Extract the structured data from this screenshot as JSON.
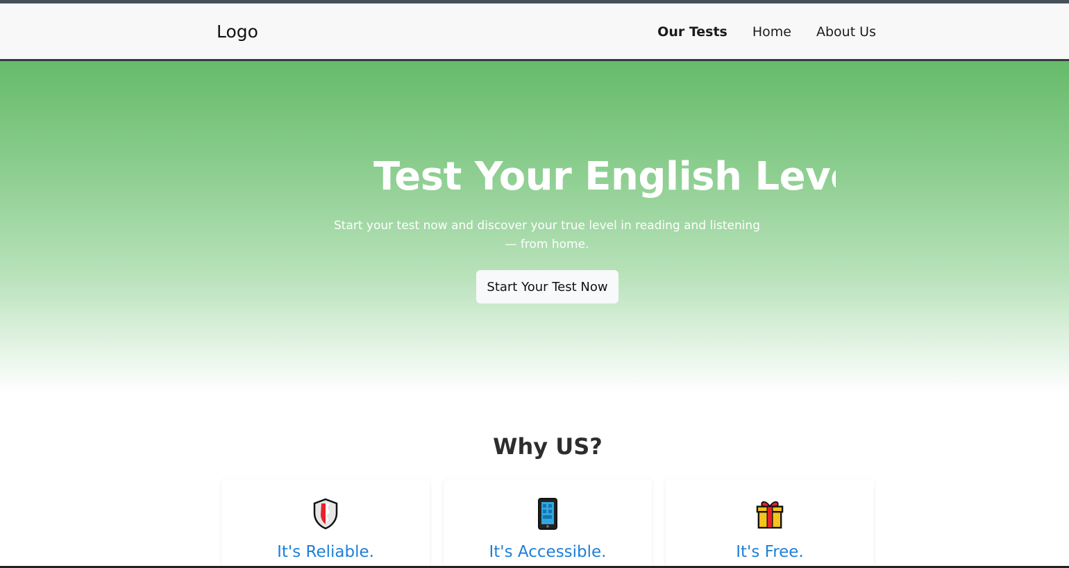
{
  "header": {
    "logo": "Logo",
    "nav": [
      "Our Tests",
      "Home",
      "About Us"
    ]
  },
  "hero": {
    "title": "Test Your English Level fo",
    "subtitle": "Start your test now and discover your true level in reading and listening — from home.",
    "button": "Start Your Test Now"
  },
  "why": {
    "title": "Why US?",
    "cards": [
      {
        "title": "It's Reliable.",
        "icon": "shield-icon"
      },
      {
        "title": "It's Accessible.",
        "icon": "mobile-phone-icon"
      },
      {
        "title": "It's Free.",
        "icon": "gift-icon"
      }
    ]
  },
  "colors": {
    "hero_green": "#66bb6a",
    "card_title_blue": "#1e7fd8",
    "navbar_border": "#343a40"
  }
}
